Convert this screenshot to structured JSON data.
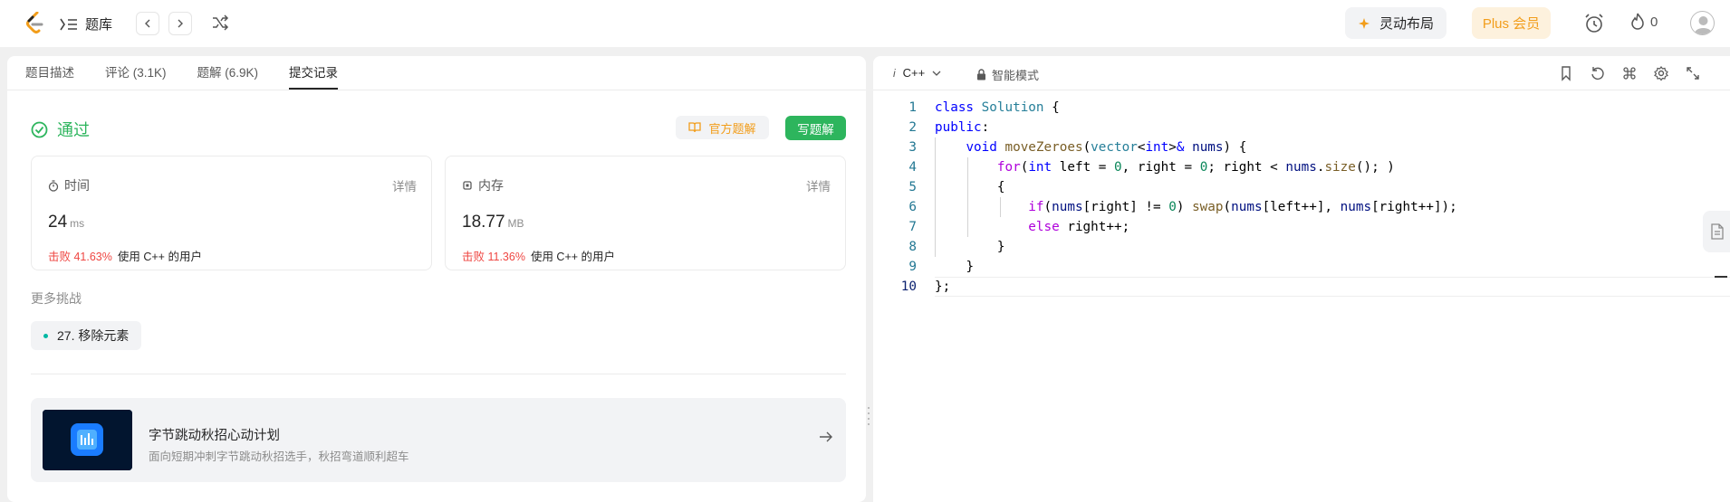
{
  "topbar": {
    "problem_list_label": "题库",
    "prev_label": "<",
    "next_label": ">",
    "layout_button_label": "灵动布局",
    "plus_button_label": "Plus 会员",
    "streak_count": "0"
  },
  "left_tabs": [
    {
      "label": "题目描述",
      "active": false
    },
    {
      "label": "评论 (3.1K)",
      "active": false
    },
    {
      "label": "题解 (6.9K)",
      "active": false
    },
    {
      "label": "提交记录",
      "active": true
    }
  ],
  "result": {
    "status": "通过",
    "official_solution_label": "官方题解",
    "write_solution_label": "写题解"
  },
  "stats": {
    "time": {
      "label": "时间",
      "detail": "详情",
      "value": "24",
      "unit": "ms",
      "beat_pct": "击败 41.63%",
      "beat_text": "使用 C++ 的用户"
    },
    "memory": {
      "label": "内存",
      "detail": "详情",
      "value": "18.77",
      "unit": "MB",
      "beat_pct": "击败 11.36%",
      "beat_text": "使用 C++ 的用户"
    }
  },
  "more_challenges": {
    "title": "更多挑战",
    "items": [
      "27. 移除元素"
    ]
  },
  "banner": {
    "title": "字节跳动秋招心动计划",
    "subtitle": "面向短期冲刺字节跳动秋招选手，秋招弯道顺利超车"
  },
  "editor": {
    "language": "C++",
    "mode_label": "智能模式",
    "line_numbers": [
      "1",
      "2",
      "3",
      "4",
      "5",
      "6",
      "7",
      "8",
      "9",
      "10"
    ],
    "current_line": 10
  },
  "colors": {
    "accent_green": "#2db55d",
    "warn_orange": "#f29d1a",
    "beat_red": "#ef4743"
  }
}
